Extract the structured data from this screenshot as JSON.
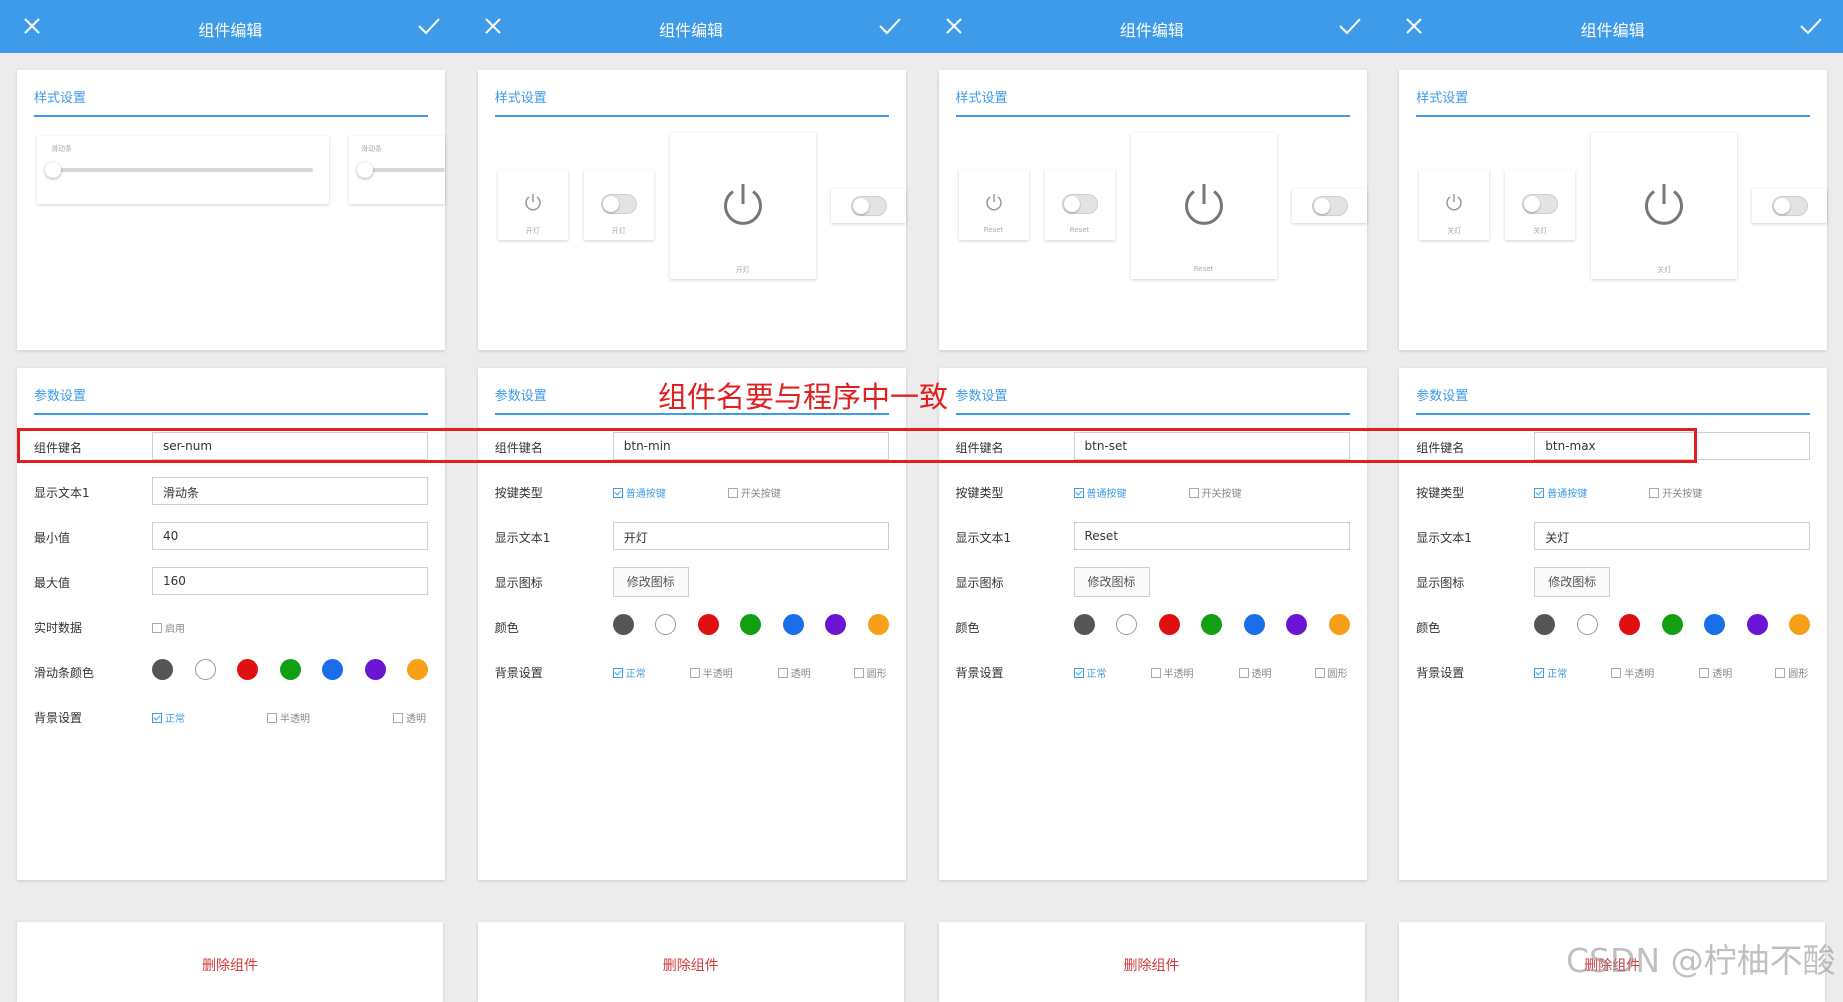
{
  "colors": {
    "topbar": "#3d9be9",
    "accent": "#3d9be9",
    "annotation": "#e02020",
    "delete": "#d23b3b"
  },
  "swatches": [
    "#555555",
    "#ffffff",
    "#e01010",
    "#12a012",
    "#1a6ee8",
    "#6a14d4",
    "#f5a018"
  ],
  "panels": [
    {
      "title": "组件编辑",
      "style_section": "样式设置",
      "param_section": "参数设置",
      "delete_label": "删除组件",
      "preview": {
        "label_a": "滑动条",
        "label_b": "滑动条"
      },
      "fields": {
        "key_label": "组件键名",
        "key_value": "ser-num",
        "text1_label": "显示文本1",
        "text1_value": "滑动条",
        "min_label": "最小值",
        "min_value": "40",
        "max_label": "最大值",
        "max_value": "160",
        "realtime_label": "实时数据",
        "realtime_opt": "启用",
        "color_label": "滑动条颜色",
        "bg_label": "背景设置",
        "bg_opt1": "正常",
        "bg_opt2": "半透明",
        "bg_opt3": "透明"
      }
    },
    {
      "title": "组件编辑",
      "style_section": "样式设置",
      "param_section": "参数设置",
      "delete_label": "删除组件",
      "preview": {
        "small_label": "开灯",
        "switch_label": "开灯",
        "big_label": "开灯"
      },
      "fields": {
        "key_label": "组件键名",
        "key_value": "btn-min",
        "type_label": "按键类型",
        "type_opt1": "普通按键",
        "type_opt2": "开关按键",
        "text1_label": "显示文本1",
        "text1_value": "开灯",
        "icon_label": "显示图标",
        "icon_button": "修改图标",
        "color_label": "颜色",
        "bg_label": "背景设置",
        "bg_opt1": "正常",
        "bg_opt2": "半透明",
        "bg_opt3": "透明",
        "bg_opt4": "圆形"
      }
    },
    {
      "title": "组件编辑",
      "style_section": "样式设置",
      "param_section": "参数设置",
      "delete_label": "删除组件",
      "preview": {
        "small_label": "Reset",
        "switch_label": "Reset",
        "big_label": "Reset"
      },
      "fields": {
        "key_label": "组件键名",
        "key_value": "btn-set",
        "type_label": "按键类型",
        "type_opt1": "普通按键",
        "type_opt2": "开关按键",
        "text1_label": "显示文本1",
        "text1_value": "Reset",
        "icon_label": "显示图标",
        "icon_button": "修改图标",
        "color_label": "颜色",
        "bg_label": "背景设置",
        "bg_opt1": "正常",
        "bg_opt2": "半透明",
        "bg_opt3": "透明",
        "bg_opt4": "圆形"
      }
    },
    {
      "title": "组件编辑",
      "style_section": "样式设置",
      "param_section": "参数设置",
      "delete_label": "删除组件",
      "preview": {
        "small_label": "关灯",
        "switch_label": "关灯",
        "big_label": "关灯"
      },
      "fields": {
        "key_label": "组件键名",
        "key_value": "btn-max",
        "type_label": "按键类型",
        "type_opt1": "普通按键",
        "type_opt2": "开关按键",
        "text1_label": "显示文本1",
        "text1_value": "关灯",
        "icon_label": "显示图标",
        "icon_button": "修改图标",
        "color_label": "颜色",
        "bg_label": "背景设置",
        "bg_opt1": "正常",
        "bg_opt2": "半透明",
        "bg_opt3": "透明",
        "bg_opt4": "圆形"
      }
    }
  ],
  "annotation": {
    "text": "组件名要与程序中一致"
  },
  "watermark": "CSDN @柠柚不酸"
}
